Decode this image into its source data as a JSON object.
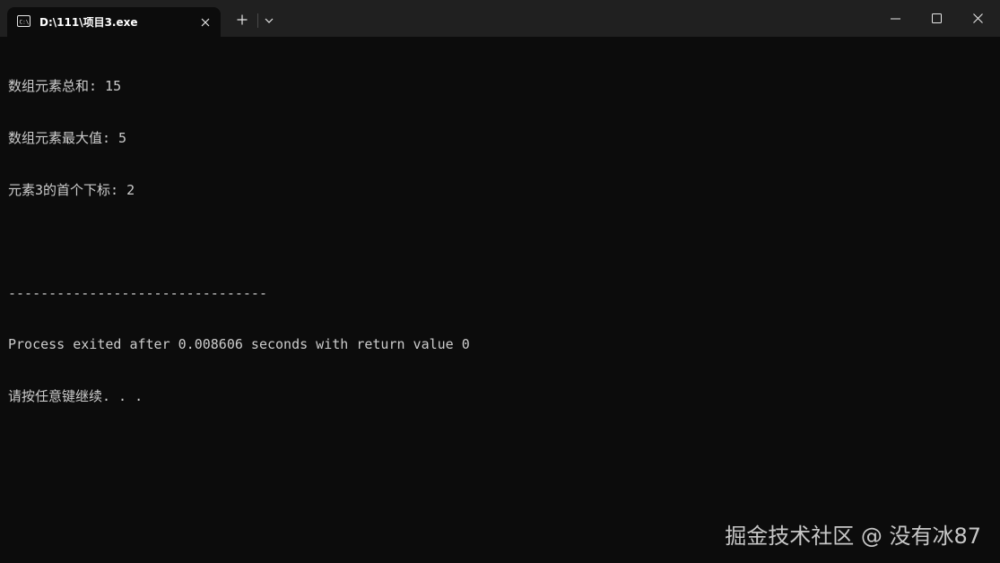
{
  "window": {
    "tab_title": "D:\\111\\项目3.exe",
    "tab_icon": "console-icon",
    "close_tab_icon": "close-icon",
    "new_tab_icon": "plus-icon",
    "dropdown_icon": "chevron-down-icon",
    "minimize_icon": "minimize-icon",
    "maximize_icon": "maximize-icon",
    "close_window_icon": "close-icon"
  },
  "console": {
    "lines": [
      "数组元素总和: 15",
      "数组元素最大值: 5",
      "元素3的首个下标: 2",
      "",
      "--------------------------------",
      "Process exited after 0.008606 seconds with return value 0",
      "请按任意键继续. . ."
    ]
  },
  "watermark": "掘金技术社区 @ 没有冰87",
  "colors": {
    "titlebar": "#202020",
    "console_bg": "#0c0c0c",
    "text": "#cccccc"
  }
}
